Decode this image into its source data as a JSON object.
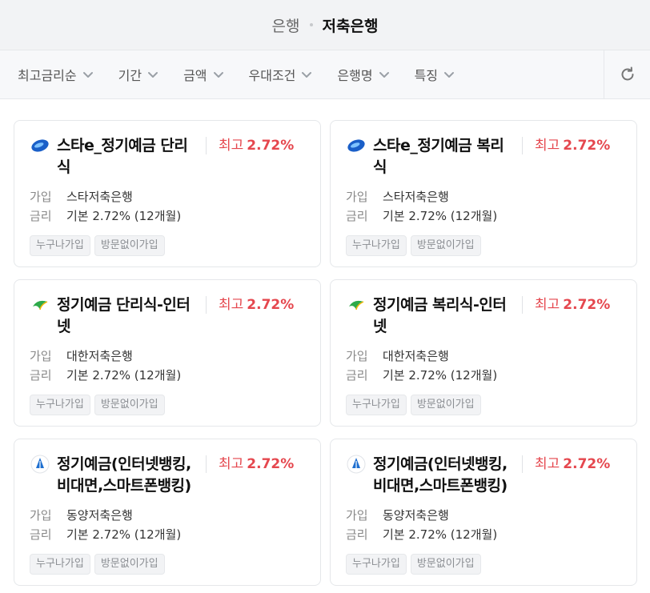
{
  "breadcrumb": {
    "parent": "은행",
    "current": "저축은행"
  },
  "filters": [
    "최고금리순",
    "기간",
    "금액",
    "우대조건",
    "은행명",
    "특징"
  ],
  "refresh_icon": "refresh-icon",
  "labels": {
    "join": "가입",
    "rate": "금리",
    "max_prefix": "최고"
  },
  "colors": {
    "accent_red": "#e5474e",
    "star_blue": "#1a5fc8",
    "daehan_green": "#2eaa4a",
    "dongyang_blue": "#1e6fd0"
  },
  "products": [
    {
      "title_line1": "스타e_정기예금 단리",
      "title_line2": "식",
      "bank": "스타저축은행",
      "rate_max": "2.72%",
      "rate_base": "기본 2.72% (12개월)",
      "tags": [
        "누구나가입",
        "방문없이가입"
      ],
      "logo": "star-bank-logo-icon"
    },
    {
      "title_line1": "스타e_정기예금 복리",
      "title_line2": "식",
      "bank": "스타저축은행",
      "rate_max": "2.72%",
      "rate_base": "기본 2.72% (12개월)",
      "tags": [
        "누구나가입",
        "방문없이가입"
      ],
      "logo": "star-bank-logo-icon"
    },
    {
      "title_line1": "정기예금 단리식-인터",
      "title_line2": "넷",
      "bank": "대한저축은행",
      "rate_max": "2.72%",
      "rate_base": "기본 2.72% (12개월)",
      "tags": [
        "누구나가입",
        "방문없이가입"
      ],
      "logo": "daehan-bank-logo-icon"
    },
    {
      "title_line1": "정기예금 복리식-인터",
      "title_line2": "넷",
      "bank": "대한저축은행",
      "rate_max": "2.72%",
      "rate_base": "기본 2.72% (12개월)",
      "tags": [
        "누구나가입",
        "방문없이가입"
      ],
      "logo": "daehan-bank-logo-icon"
    },
    {
      "title_line1": "정기예금(인터넷뱅킹,",
      "title_line2": "비대면,스마트폰뱅킹)",
      "bank": "동양저축은행",
      "rate_max": "2.72%",
      "rate_base": "기본 2.72% (12개월)",
      "tags": [
        "누구나가입",
        "방문없이가입"
      ],
      "logo": "dongyang-bank-logo-icon"
    },
    {
      "title_line1": "정기예금(인터넷뱅킹,",
      "title_line2": "비대면,스마트폰뱅킹)",
      "bank": "동양저축은행",
      "rate_max": "2.72%",
      "rate_base": "기본 2.72% (12개월)",
      "tags": [
        "누구나가입",
        "방문없이가입"
      ],
      "logo": "dongyang-bank-logo-icon"
    }
  ]
}
